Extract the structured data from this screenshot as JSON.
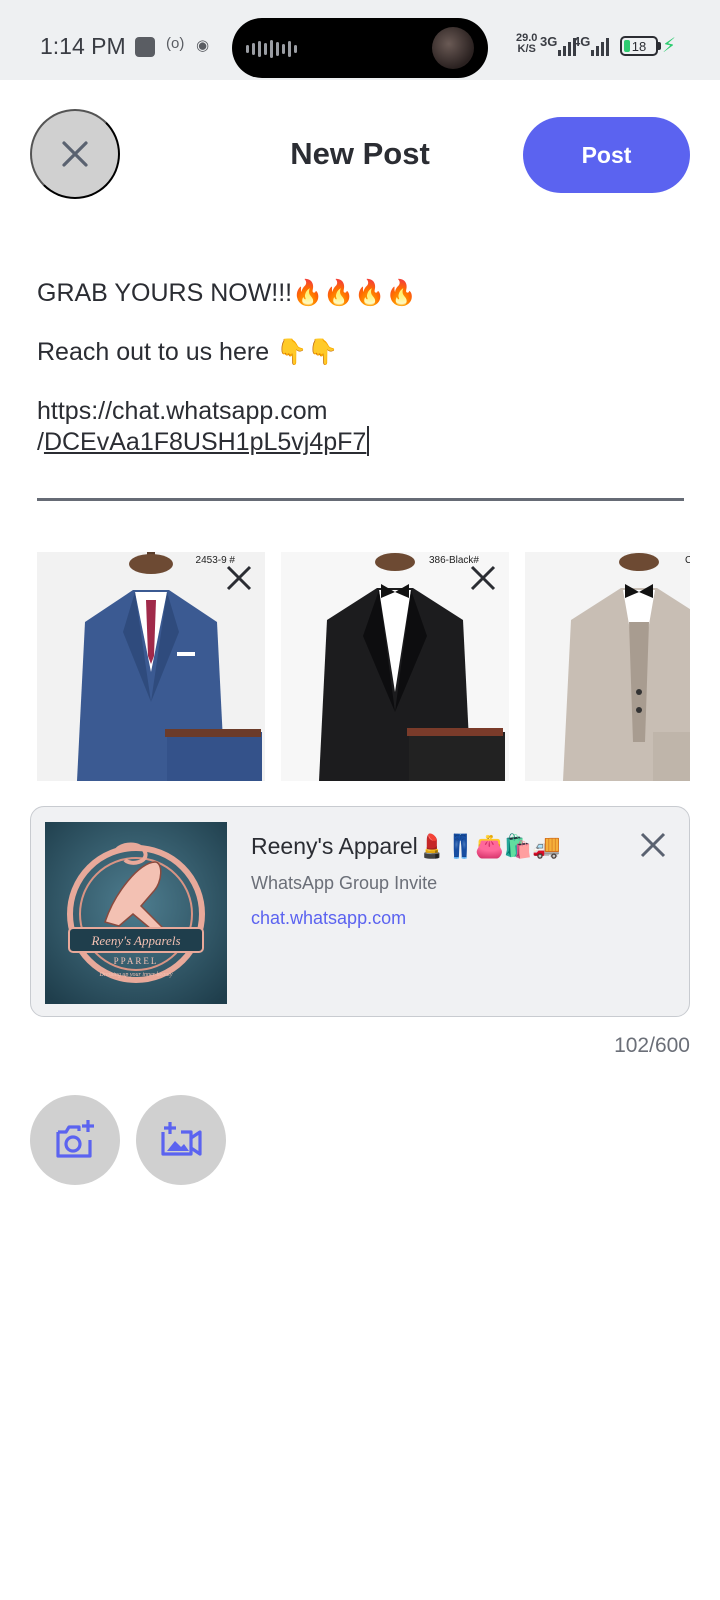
{
  "status_bar": {
    "time": "1:14 PM",
    "speed_value": "29.0",
    "speed_unit": "K/S",
    "net1": "3G",
    "net2": "4G",
    "battery_level": "18",
    "icons": [
      "notification-square-icon",
      "radio-icon",
      "camera-icon",
      "signal-icon",
      "battery-icon",
      "charging-icon"
    ]
  },
  "header": {
    "title": "New Post",
    "post_label": "Post",
    "close_icon": "close-icon"
  },
  "composer": {
    "line1": "GRAB YOURS NOW!!!🔥🔥🔥🔥",
    "line2": "Reach out to us here 👇👇",
    "link_line1": "https://chat.whatsapp.com",
    "link_line2_prefix": "/",
    "link_line2_rest": "DCEvAa1F8USH1pL5vj4pF7"
  },
  "media": {
    "items": [
      {
        "code": "2453-9 #",
        "suit_color": "#3b5a92"
      },
      {
        "code": "386-Black#",
        "suit_color": "#1c1c1e"
      },
      {
        "code": "C",
        "suit_color": "#c8beb4"
      }
    ],
    "remove_icon": "close-icon"
  },
  "link_preview": {
    "title": "Reeny's Apparel💄👖👛🛍️🚚",
    "subtitle": "WhatsApp Group Invite",
    "url": "chat.whatsapp.com",
    "logo_text": "Reeny's Apparels",
    "logo_sub": "PPAREL",
    "logo_tagline": "Dressing up your inner beauty"
  },
  "counter": "102/600",
  "actions": {
    "camera_icon": "add-photo-camera-icon",
    "video_icon": "add-video-icon"
  },
  "colors": {
    "accent": "#5b63f0",
    "button_grey": "#d0d0d0"
  }
}
